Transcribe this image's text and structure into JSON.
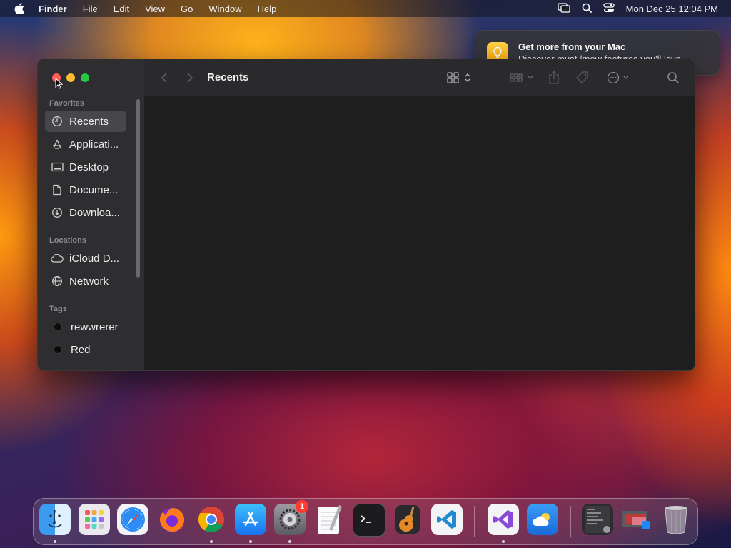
{
  "menubar": {
    "app_name": "Finder",
    "menus": [
      "File",
      "Edit",
      "View",
      "Go",
      "Window",
      "Help"
    ],
    "clock": "Mon Dec 25  12:04 PM",
    "status_icons": [
      "screen-mirroring-icon",
      "spotlight-search-icon",
      "control-center-icon"
    ]
  },
  "notification": {
    "title": "Get more from your Mac",
    "body": "Discover must-know features you'll love.",
    "icon": "lightbulb-icon"
  },
  "finder": {
    "title": "Recents",
    "sections": {
      "favorites": "Favorites",
      "locations": "Locations",
      "tags": "Tags"
    },
    "favorites": [
      {
        "label": "Recents",
        "icon": "clock-icon",
        "selected": true
      },
      {
        "label": "Applicati...",
        "icon": "applications-icon"
      },
      {
        "label": "Desktop",
        "icon": "desktop-icon"
      },
      {
        "label": "Docume...",
        "icon": "document-icon"
      },
      {
        "label": "Downloa...",
        "icon": "download-icon"
      }
    ],
    "locations": [
      {
        "label": "iCloud D...",
        "icon": "cloud-icon"
      },
      {
        "label": "Network",
        "icon": "network-icon"
      }
    ],
    "tags": [
      {
        "label": "rewwrerer"
      },
      {
        "label": "Red"
      }
    ]
  },
  "dock": {
    "apps": [
      {
        "name": "Finder",
        "icon": "finder-icon",
        "running": true
      },
      {
        "name": "Launchpad",
        "icon": "launchpad-icon"
      },
      {
        "name": "Safari",
        "icon": "safari-icon"
      },
      {
        "name": "Firefox",
        "icon": "firefox-icon"
      },
      {
        "name": "Chrome",
        "icon": "chrome-icon",
        "running": true
      },
      {
        "name": "App Store",
        "icon": "app-store-icon",
        "running": true
      },
      {
        "name": "System Settings",
        "icon": "settings-icon",
        "running": true,
        "badge": "1"
      },
      {
        "name": "TextEdit",
        "icon": "textedit-icon"
      },
      {
        "name": "Terminal",
        "icon": "terminal-icon"
      },
      {
        "name": "GarageBand",
        "icon": "garageband-icon"
      },
      {
        "name": "VS Code",
        "icon": "vscode-icon"
      },
      {
        "name": "Visual Studio",
        "icon": "visual-studio-icon",
        "running": true
      },
      {
        "name": "Weather",
        "icon": "weather-icon"
      }
    ],
    "trash_icon": "trash-icon"
  }
}
